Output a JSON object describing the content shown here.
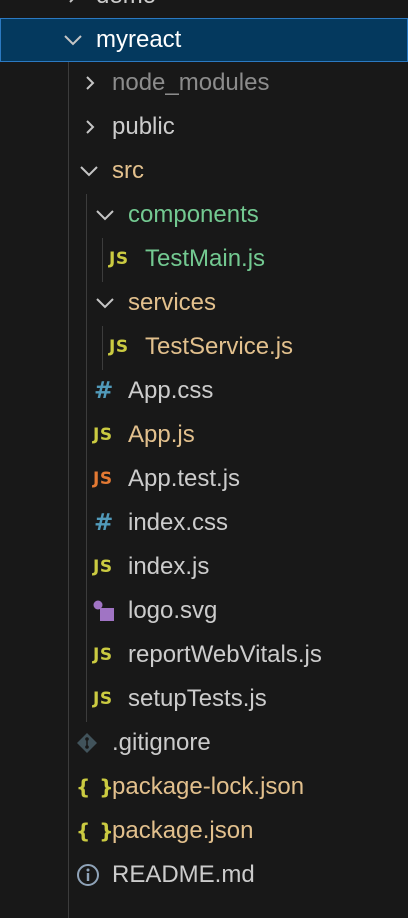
{
  "colors": {
    "background": "#181818",
    "selection_bg": "#04395e",
    "selection_border": "#2b79c2",
    "text_default": "#cccccc",
    "text_ignored": "#8c8c8c",
    "text_git_untracked": "#73c991",
    "text_git_modified": "#e2c08d",
    "icon_js": "#cbcb41",
    "icon_js_test": "#e37933",
    "icon_css": "#519aba",
    "icon_svg": "#a074c4"
  },
  "tree": [
    {
      "name": "demo",
      "type": "folder",
      "state": "collapsed",
      "icon": "chevron-right-icon"
    },
    {
      "name": "myreact",
      "type": "folder",
      "state": "expanded",
      "selected": true,
      "icon": "chevron-down-icon"
    },
    {
      "name": "node_modules",
      "type": "folder",
      "state": "collapsed",
      "icon": "chevron-right-icon"
    },
    {
      "name": "public",
      "type": "folder",
      "state": "collapsed",
      "icon": "chevron-right-icon"
    },
    {
      "name": "src",
      "type": "folder",
      "state": "expanded",
      "icon": "chevron-down-icon"
    },
    {
      "name": "components",
      "type": "folder",
      "state": "expanded",
      "icon": "chevron-down-icon"
    },
    {
      "name": "TestMain.js",
      "type": "file",
      "icon": "js-file-icon",
      "icon_text": "JS"
    },
    {
      "name": "services",
      "type": "folder",
      "state": "expanded",
      "icon": "chevron-down-icon"
    },
    {
      "name": "TestService.js",
      "type": "file",
      "icon": "js-file-icon",
      "icon_text": "JS"
    },
    {
      "name": "App.css",
      "type": "file",
      "icon": "css-file-icon",
      "icon_text": "#"
    },
    {
      "name": "App.js",
      "type": "file",
      "icon": "js-file-icon",
      "icon_text": "JS"
    },
    {
      "name": "App.test.js",
      "type": "file",
      "icon": "js-test-file-icon",
      "icon_text": "JS"
    },
    {
      "name": "index.css",
      "type": "file",
      "icon": "css-file-icon",
      "icon_text": "#"
    },
    {
      "name": "index.js",
      "type": "file",
      "icon": "js-file-icon",
      "icon_text": "JS"
    },
    {
      "name": "logo.svg",
      "type": "file",
      "icon": "svg-file-icon"
    },
    {
      "name": "reportWebVitals.js",
      "type": "file",
      "icon": "js-file-icon",
      "icon_text": "JS"
    },
    {
      "name": "setupTests.js",
      "type": "file",
      "icon": "js-file-icon",
      "icon_text": "JS"
    },
    {
      "name": ".gitignore",
      "type": "file",
      "icon": "git-file-icon"
    },
    {
      "name": "package-lock.json",
      "type": "file",
      "icon": "json-file-icon",
      "icon_text": "{ }"
    },
    {
      "name": "package.json",
      "type": "file",
      "icon": "json-file-icon",
      "icon_text": "{ }"
    },
    {
      "name": "README.md",
      "type": "file",
      "icon": "info-file-icon"
    }
  ]
}
